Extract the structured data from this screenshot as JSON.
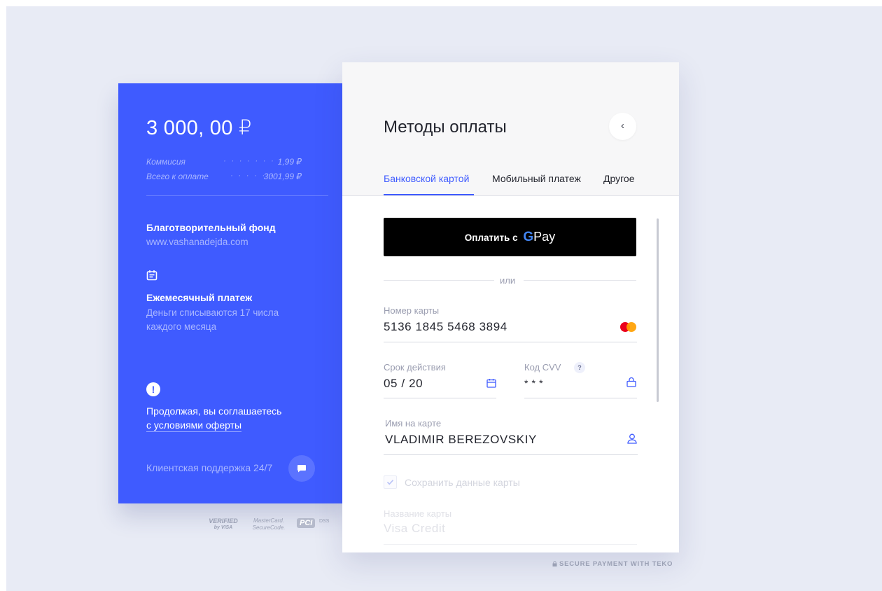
{
  "order": {
    "amount": "3 000, 00 ₽",
    "fees": [
      {
        "label": "Коммисия",
        "dots": "· · · · · · · · ·",
        "value": "1,99 ₽"
      },
      {
        "label": "Всего к оплате",
        "dots": "· · · · · ·",
        "value": "3001,99 ₽"
      }
    ],
    "merchant_name": "Благотворительный фонд",
    "merchant_url": "www.vashanadejda.com",
    "recurring_title": "Ежемесячный платеж",
    "recurring_desc": "Деньги списываются 17 числа каждого месяца",
    "terms_prefix": "Продолжая, вы соглашаетесь",
    "terms_link": "с условиями оферты",
    "support_label": "Клиентская поддержка 24/7"
  },
  "badges": {
    "visa_top": "VERIFIED",
    "visa_bottom": "by VISA",
    "mc_top": "MasterCard.",
    "mc_bottom": "SecureCode.",
    "pci": "PCI",
    "dss": "DSS"
  },
  "payment": {
    "title": "Методы оплаты",
    "tabs": [
      {
        "label": "Банковской картой",
        "active": true
      },
      {
        "label": "Мобильный платеж",
        "active": false
      },
      {
        "label": "Другое",
        "active": false
      }
    ],
    "gpay_prefix": "Оплатить с",
    "gpay_g": "G",
    "gpay_pay": "Pay",
    "or_text": "или",
    "card_number_label": "Номер карты",
    "card_number_value": "5136 1845 5468 3894",
    "expiry_label": "Срок действия",
    "expiry_value": "05 / 20",
    "cvv_label": "Код CVV",
    "cvv_help": "?",
    "cvv_value": "* * *",
    "holder_label": "Имя на карте",
    "holder_value": "VLADIMIR BEREZOVSKIY",
    "save_card_label": "Сохранить данные карты",
    "card_name_label": "Название карты",
    "card_name_value": "Visa Credit",
    "back_glyph": "‹"
  },
  "footer": {
    "secure_text": "SECURE PAYMENT WITH TEKO"
  },
  "colors": {
    "accent": "#3f5bff",
    "background": "#e8ebf5",
    "mastercard_red": "#eb001b",
    "mastercard_orange": "#ff9f00"
  }
}
